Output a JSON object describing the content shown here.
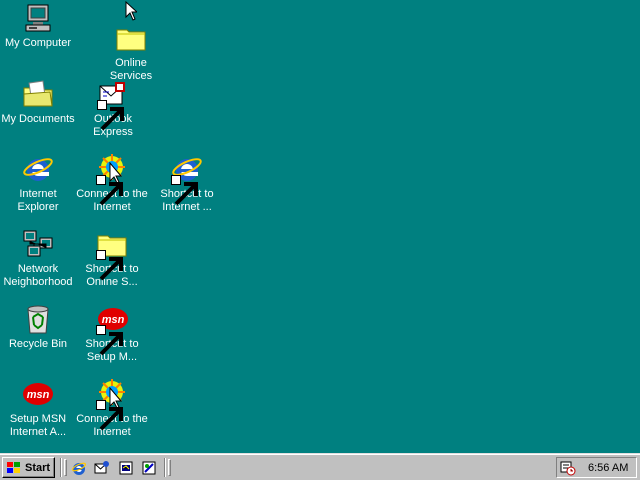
{
  "desktop": {
    "icons": [
      {
        "label": "My Computer"
      },
      {
        "label": "Online Services"
      },
      {
        "label": "My Documents"
      },
      {
        "label": "Outlook Express"
      },
      {
        "label": "Internet Explorer"
      },
      {
        "label": "Connect to the Internet"
      },
      {
        "label": "Shortcut to Internet ..."
      },
      {
        "label": "Network Neighborhood"
      },
      {
        "label": "Shortcut to Online S..."
      },
      {
        "label": "Recycle Bin"
      },
      {
        "label": "Shortcut to Setup M..."
      },
      {
        "label": "Setup MSN Internet A..."
      },
      {
        "label": "Connect to the Internet"
      }
    ],
    "background_color": "#008080"
  },
  "taskbar": {
    "start_label": "Start",
    "quick_launch": [
      "internet-explorer-icon",
      "outlook-express-icon",
      "show-desktop-icon",
      "view-channels-icon"
    ],
    "clock": "6:56 AM"
  }
}
